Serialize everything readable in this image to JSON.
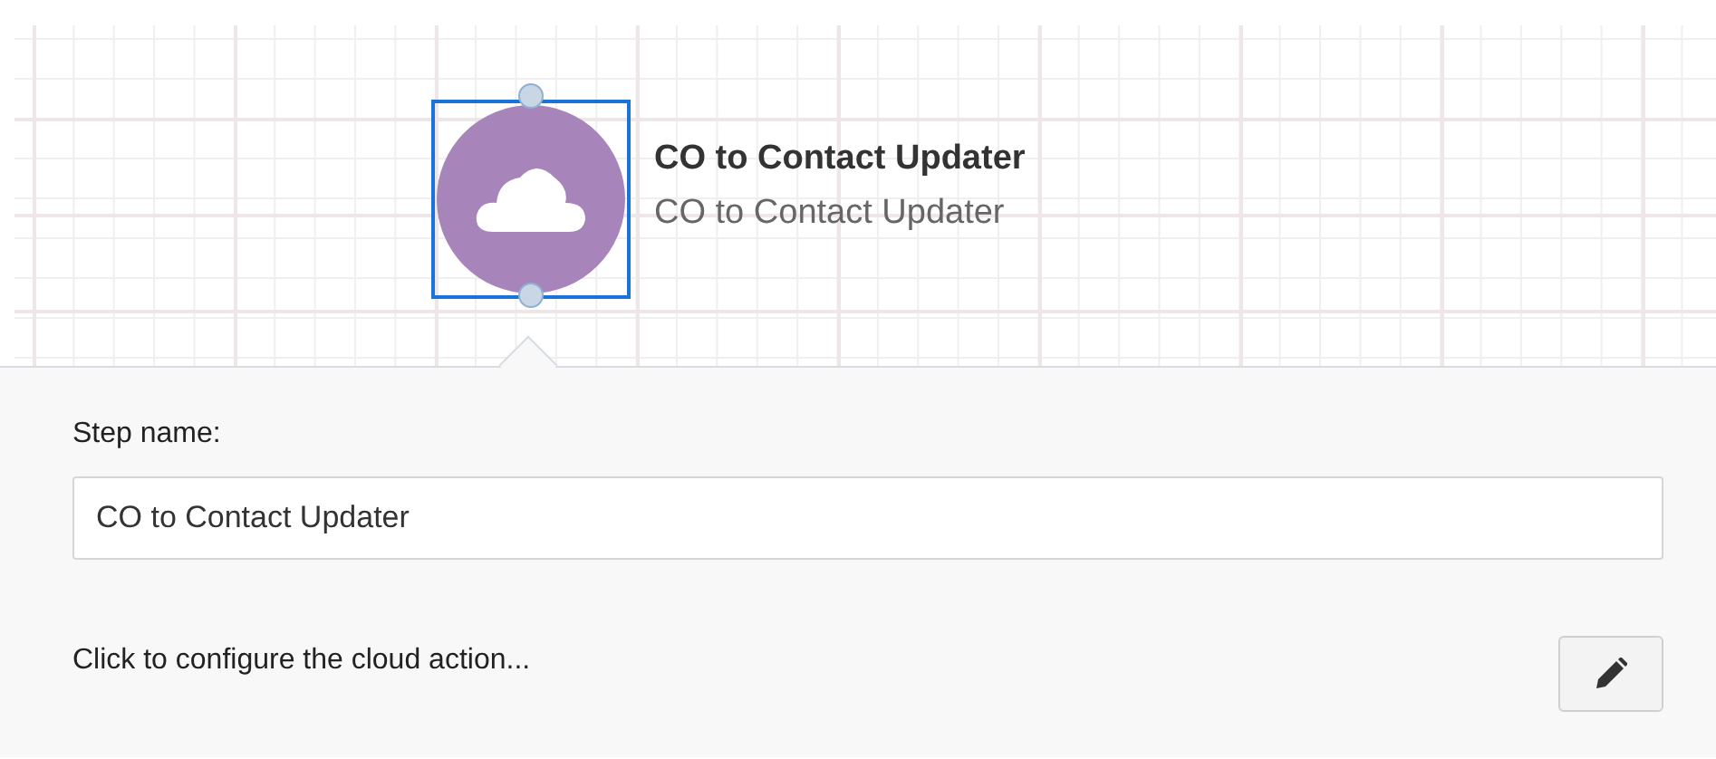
{
  "node": {
    "title": "CO to Contact Updater",
    "subtitle": "CO to Contact Updater",
    "selected": true
  },
  "panel": {
    "label": "Step name:",
    "value": "CO to Contact Updater",
    "action_text": "Click to configure the cloud action..."
  }
}
